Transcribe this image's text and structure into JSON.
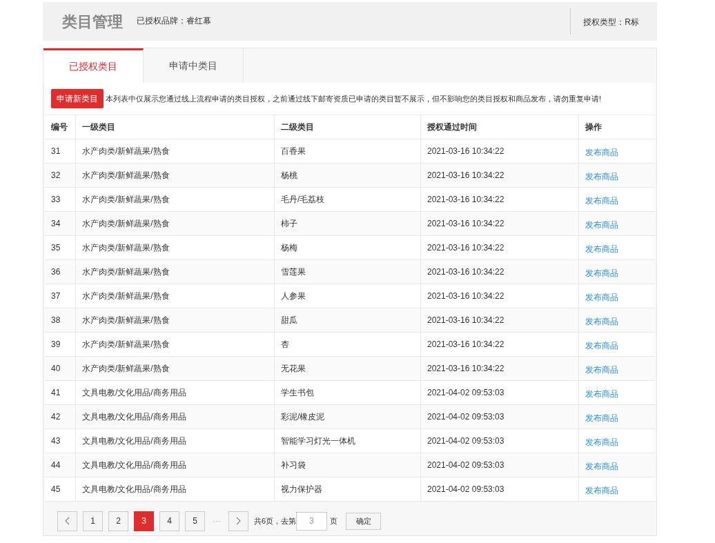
{
  "header": {
    "title": "类目管理",
    "brand": "已授权品牌：睿红幕",
    "auth_type": "授权类型：R标"
  },
  "tabs": [
    {
      "label": "已授权类目",
      "selected": true
    },
    {
      "label": "申请中类目",
      "selected": false
    }
  ],
  "notice": {
    "button": "申请新类目",
    "text": "本列表中仅展示您通过线上流程申请的类目授权，之前通过线下邮寄资质已申请的类目暂不展示，但不影响您的类目授权和商品发布，请勿重复申请!"
  },
  "table": {
    "columns": [
      "编号",
      "一级类目",
      "二级类目",
      "授权通过时间",
      "操作"
    ],
    "rows": [
      [
        "31",
        "水产肉类/新鲜蔬果/熟食",
        "百香果",
        "2021-03-16 10:34:22",
        "发布商品"
      ],
      [
        "32",
        "水产肉类/新鲜蔬果/熟食",
        "杨桃",
        "2021-03-16 10:34:22",
        "发布商品"
      ],
      [
        "33",
        "水产肉类/新鲜蔬果/熟食",
        "毛丹/毛荔枝",
        "2021-03-16 10:34:22",
        "发布商品"
      ],
      [
        "34",
        "水产肉类/新鲜蔬果/熟食",
        "柿子",
        "2021-03-16 10:34:22",
        "发布商品"
      ],
      [
        "35",
        "水产肉类/新鲜蔬果/熟食",
        "杨梅",
        "2021-03-16 10:34:22",
        "发布商品"
      ],
      [
        "36",
        "水产肉类/新鲜蔬果/熟食",
        "雪莲果",
        "2021-03-16 10:34:22",
        "发布商品"
      ],
      [
        "37",
        "水产肉类/新鲜蔬果/熟食",
        "人参果",
        "2021-03-16 10:34:22",
        "发布商品"
      ],
      [
        "38",
        "水产肉类/新鲜蔬果/熟食",
        "甜瓜",
        "2021-03-16 10:34:22",
        "发布商品"
      ],
      [
        "39",
        "水产肉类/新鲜蔬果/熟食",
        "杏",
        "2021-03-16 10:34:22",
        "发布商品"
      ],
      [
        "40",
        "水产肉类/新鲜蔬果/熟食",
        "无花果",
        "2021-03-16 10:34:22",
        "发布商品"
      ],
      [
        "41",
        "文具电教/文化用品/商务用品",
        "学生书包",
        "2021-04-02 09:53:03",
        "发布商品"
      ],
      [
        "42",
        "文具电教/文化用品/商务用品",
        "彩泥/橡皮泥",
        "2021-04-02 09:53:03",
        "发布商品"
      ],
      [
        "43",
        "文具电教/文化用品/商务用品",
        "智能学习灯光一体机",
        "2021-04-02 09:53:03",
        "发布商品"
      ],
      [
        "44",
        "文具电教/文化用品/商务用品",
        "补习袋",
        "2021-04-02 09:53:03",
        "发布商品"
      ],
      [
        "45",
        "文具电教/文化用品/商务用品",
        "视力保护器",
        "2021-04-02 09:53:03",
        "发布商品"
      ]
    ]
  },
  "pagination": {
    "pages": [
      {
        "label": "1",
        "selected": false
      },
      {
        "label": "2",
        "selected": false
      },
      {
        "label": "3",
        "selected": true
      },
      {
        "label": "4",
        "selected": false
      },
      {
        "label": "5",
        "selected": false
      }
    ],
    "ellipsis": "···",
    "total": "共6页，去第",
    "page_value": "3",
    "page_suffix": "页",
    "confirm": "确定"
  }
}
